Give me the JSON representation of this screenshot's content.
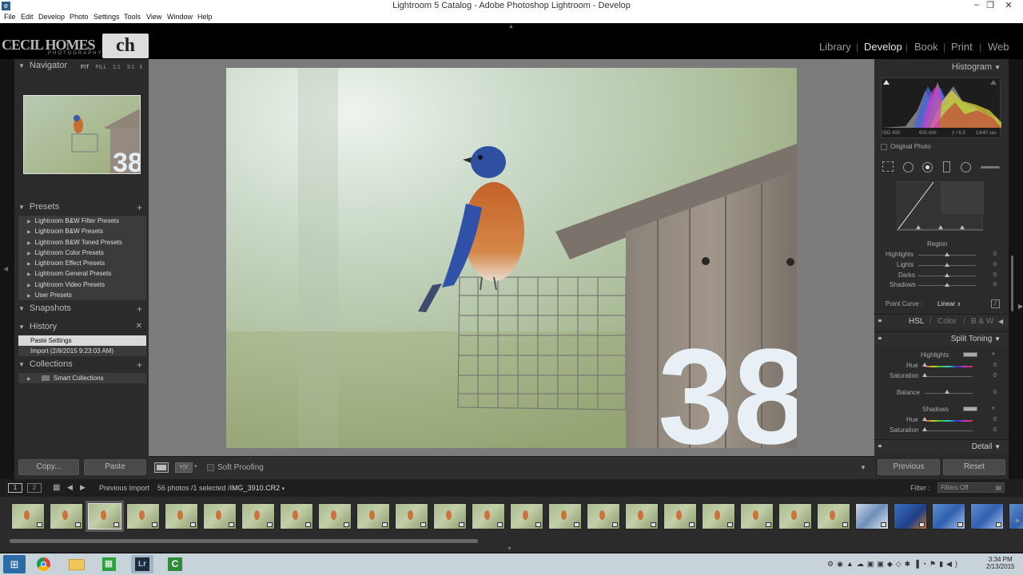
{
  "window": {
    "title": "Lightroom 5 Catalog - Adobe Photoshop Lightroom - Develop"
  },
  "menu": [
    "File",
    "Edit",
    "Develop",
    "Photo",
    "Settings",
    "Tools",
    "View",
    "Window",
    "Help"
  ],
  "identity_plate": {
    "text": "CECIL HOMES",
    "sub": "PHOTOGRAPHY",
    "monogram": "ch"
  },
  "modules": [
    "Library",
    "Develop",
    "Book",
    "Print",
    "Web"
  ],
  "active_module": "Develop",
  "left": {
    "navigator": {
      "title": "Navigator",
      "zoom": [
        "FIT",
        "FILL",
        "1:1",
        "3:1"
      ]
    },
    "presets": {
      "title": "Presets",
      "items": [
        "Lightroom B&W Filter Presets",
        "Lightroom B&W Presets",
        "Lightroom B&W Toned Presets",
        "Lightroom Color Presets",
        "Lightroom Effect Presets",
        "Lightroom General Presets",
        "Lightroom Video Presets",
        "User Presets"
      ]
    },
    "snapshots": {
      "title": "Snapshots"
    },
    "history": {
      "title": "History",
      "items": [
        "Paste Settings",
        "Import (2/8/2015 9:23:03 AM)"
      ]
    },
    "collections": {
      "title": "Collections",
      "items": [
        "Smart Collections"
      ]
    },
    "copy_label": "Copy...",
    "paste_label": "Paste"
  },
  "toolbar": {
    "soft_proofing": "Soft Proofing",
    "compare": "Y|Y"
  },
  "right": {
    "histogram": {
      "title": "Histogram",
      "iso": "ISO 400",
      "focal": "600 mm",
      "aperture": "ƒ / 6.3",
      "shutter": "1/640 sec",
      "original_photo": "Original Photo"
    },
    "tone_curve": {
      "region": "Region",
      "sliders": [
        {
          "label": "Highlights",
          "value": "0"
        },
        {
          "label": "Lights",
          "value": "0"
        },
        {
          "label": "Darks",
          "value": "0"
        },
        {
          "label": "Shadows",
          "value": "0"
        }
      ],
      "point_curve_label": "Point Curve :",
      "point_curve_value": "Linear"
    },
    "hsl_tabs": [
      "HSL",
      "Color",
      "B & W"
    ],
    "split_toning": {
      "title": "Split Toning",
      "highlights": "Highlights",
      "shadows": "Shadows",
      "hue": "Hue",
      "saturation": "Saturation",
      "balance": "Balance",
      "values": {
        "h_hue": "0",
        "h_sat": "0",
        "balance": "0",
        "s_hue": "0",
        "s_sat": "0"
      }
    },
    "detail": {
      "title": "Detail"
    },
    "previous_label": "Previous",
    "reset_label": "Reset"
  },
  "filmbar": {
    "view1": "1",
    "view2": "2",
    "source": "Previous Import",
    "count": "56 photos /1 selected /",
    "filename": "IMG_3910.CR2",
    "filter_label": "Filter :",
    "filter_value": "Filters Off"
  },
  "filmstrip_thumbs": [
    "bird",
    "bird",
    "bird",
    "bird",
    "bird",
    "bird",
    "bird",
    "bird",
    "bird",
    "bird",
    "bird",
    "bird",
    "bird",
    "bird",
    "bird",
    "bird",
    "bird",
    "bird",
    "bird",
    "bird",
    "bird",
    "bird",
    "frost",
    "blue",
    "sky",
    "sky",
    "sky"
  ],
  "taskbar": {
    "time": "3:34 PM",
    "date": "2/13/2015"
  }
}
